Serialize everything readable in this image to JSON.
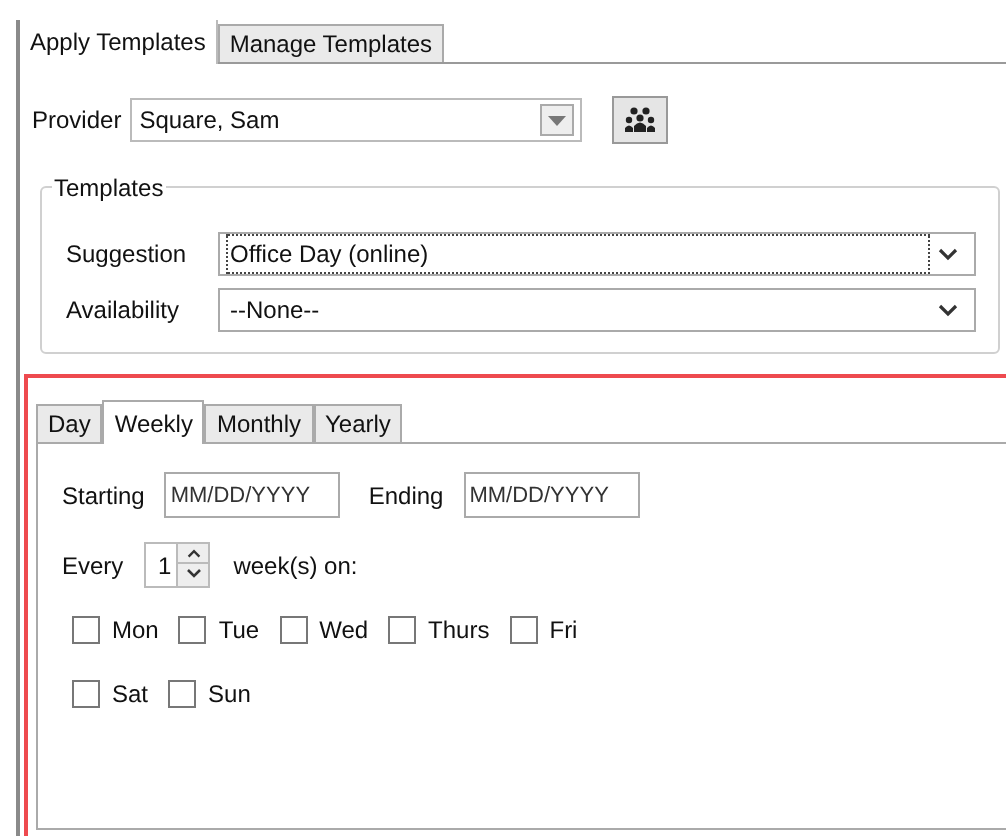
{
  "main_tabs": [
    {
      "label": "Apply Templates",
      "selected": true
    },
    {
      "label": "Manage Templates",
      "selected": false
    }
  ],
  "provider": {
    "label": "Provider",
    "value": "Square, Sam"
  },
  "templates": {
    "legend": "Templates",
    "fields": [
      {
        "label": "Suggestion",
        "value": "Office Day (online)",
        "focused": true
      },
      {
        "label": "Availability",
        "value": "--None--",
        "focused": false
      }
    ]
  },
  "recurrence_tabs": [
    {
      "label": "Day",
      "selected": false
    },
    {
      "label": "Weekly",
      "selected": true
    },
    {
      "label": "Monthly",
      "selected": false
    },
    {
      "label": "Yearly",
      "selected": false
    }
  ],
  "starting": {
    "label": "Starting",
    "placeholder": "MM/DD/YYYY"
  },
  "ending": {
    "label": "Ending",
    "placeholder": "MM/DD/YYYY"
  },
  "every": {
    "label": "Every",
    "value": "1",
    "suffix": "week(s) on:"
  },
  "day_rows": [
    [
      {
        "label": "Mon",
        "checked": false
      },
      {
        "label": "Tue",
        "checked": false
      },
      {
        "label": "Wed",
        "checked": false
      },
      {
        "label": "Thurs",
        "checked": false
      },
      {
        "label": "Fri",
        "checked": false
      }
    ],
    [
      {
        "label": "Sat",
        "checked": false
      },
      {
        "label": "Sun",
        "checked": false
      }
    ]
  ]
}
